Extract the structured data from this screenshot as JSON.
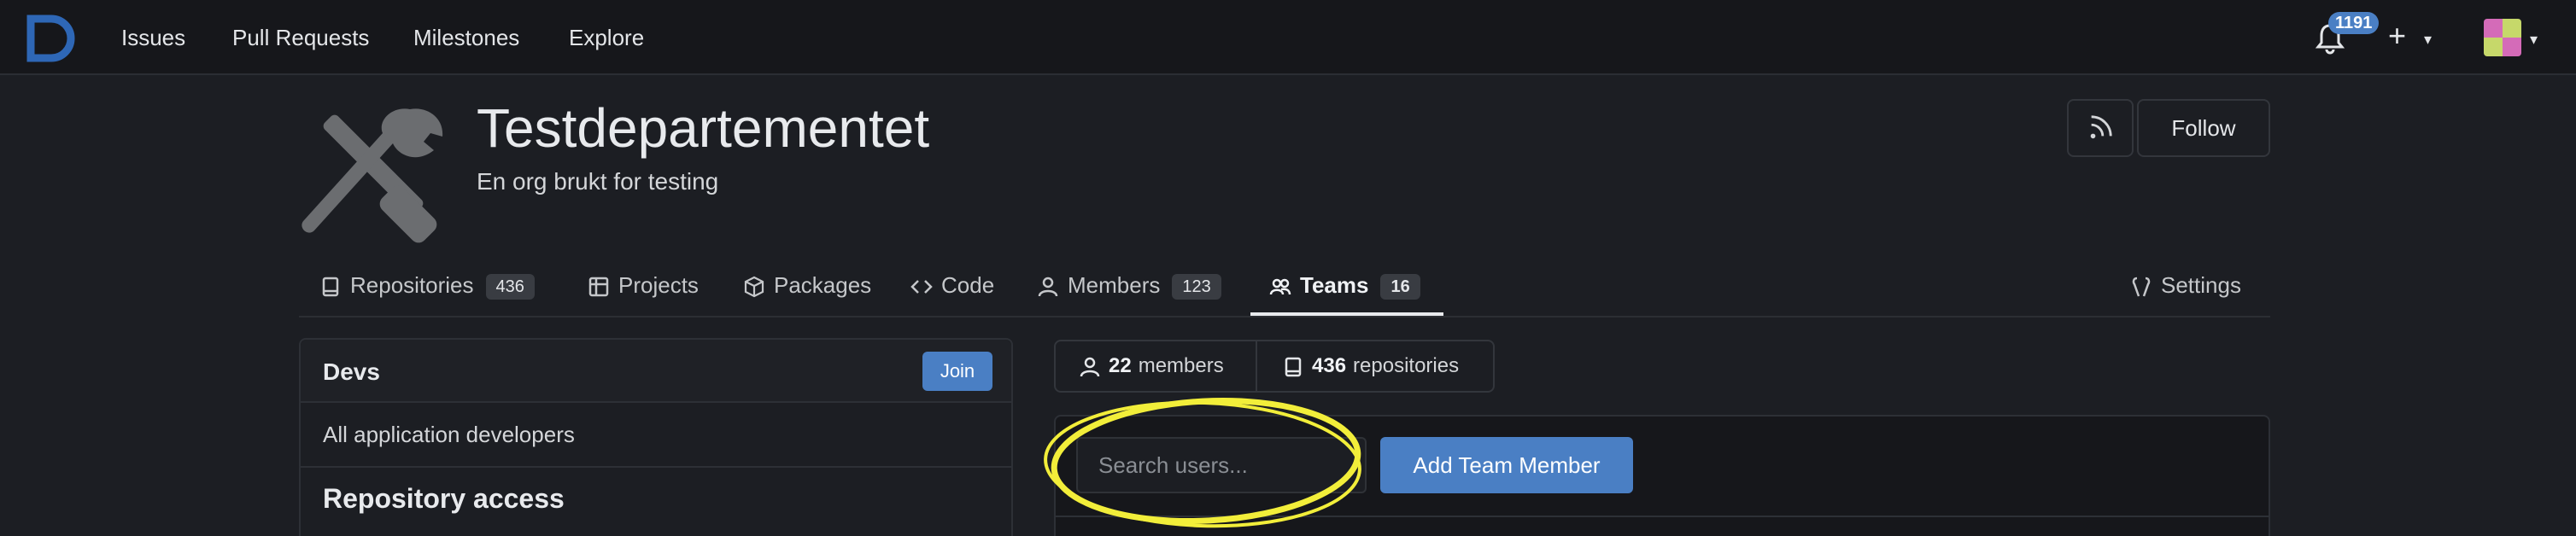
{
  "nav": {
    "links": [
      "Issues",
      "Pull Requests",
      "Milestones",
      "Explore"
    ],
    "notification_count": "1191",
    "plus_label": "+"
  },
  "org": {
    "name": "Testdepartementet",
    "description": "En org brukt for testing",
    "follow_label": "Follow"
  },
  "tabs": [
    {
      "label": "Repositories",
      "count": "436",
      "icon": "repo-icon"
    },
    {
      "label": "Projects",
      "icon": "project-icon"
    },
    {
      "label": "Packages",
      "icon": "package-icon"
    },
    {
      "label": "Code",
      "icon": "code-icon"
    },
    {
      "label": "Members",
      "count": "123",
      "icon": "person-icon"
    },
    {
      "label": "Teams",
      "count": "16",
      "icon": "people-icon",
      "active": true
    },
    {
      "label": "Settings",
      "icon": "tools-icon"
    }
  ],
  "team": {
    "name": "Devs",
    "join_label": "Join",
    "description": "All application developers",
    "repo_access_heading": "Repository access"
  },
  "stats": {
    "members_count": "22",
    "members_label": "members",
    "repos_count": "436",
    "repos_label": "repositories"
  },
  "members_panel": {
    "search_placeholder": "Search users...",
    "add_label": "Add Team Member"
  },
  "colors": {
    "accent": "#4a7fc4",
    "highlight": "#f2ee3a"
  }
}
